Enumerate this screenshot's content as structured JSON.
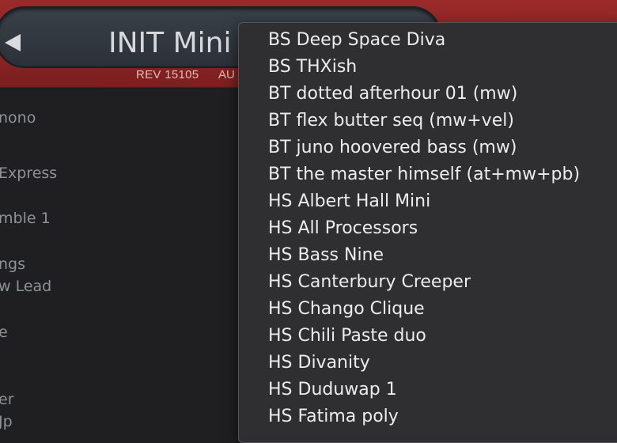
{
  "header": {
    "preset_name": "INIT Mini",
    "revision": "REV 15105",
    "format": "AU"
  },
  "left_list": {
    "items": [
      "nono",
      "Express",
      "mble 1",
      "ngs",
      "w Lead",
      "e",
      "er",
      "Jp"
    ]
  },
  "menu": {
    "items": [
      "BS Deep Space Diva",
      "BS THXish",
      "BT dotted afterhour 01 (mw)",
      "BT flex butter seq (mw+vel)",
      "BT juno hoovered bass (mw)",
      "BT the master himself (at+mw+pb)",
      "HS Albert Hall Mini",
      "HS All Processors",
      "HS Bass Nine",
      "HS Canterbury Creeper",
      "HS Chango Clique",
      "HS Chili Paste duo",
      "HS Divanity",
      "HS Duduwap 1",
      "HS Fatima poly"
    ]
  }
}
